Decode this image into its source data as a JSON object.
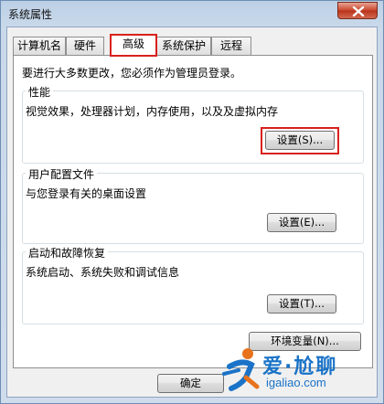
{
  "window": {
    "title": "系统属性"
  },
  "tabs": [
    {
      "label": "计算机名"
    },
    {
      "label": "硬件"
    },
    {
      "label": "高级"
    },
    {
      "label": "系统保护"
    },
    {
      "label": "远程"
    }
  ],
  "active_tab": "高级",
  "notice": "要进行大多数更改，您必须作为管理员登录。",
  "performance": {
    "title": "性能",
    "description": "视觉效果，处理器计划，内存使用，以及及虚拟内存",
    "button": "设置(S)..."
  },
  "user_profiles": {
    "title": "用户配置文件",
    "description": "与您登录有关的桌面设置",
    "button": "设置(E)..."
  },
  "startup_recovery": {
    "title": "启动和故障恢复",
    "description": "系统启动、系统失败和调试信息",
    "button": "设置(T)..."
  },
  "env_button": "环境变量(N)...",
  "ok_button": "确定",
  "watermark": {
    "top": "爱·尬聊",
    "bottom": "igaliao.com",
    "color": "#1a73c7"
  },
  "colors": {
    "highlight": "#d8211c",
    "titlebar": "#bcd0e6"
  }
}
